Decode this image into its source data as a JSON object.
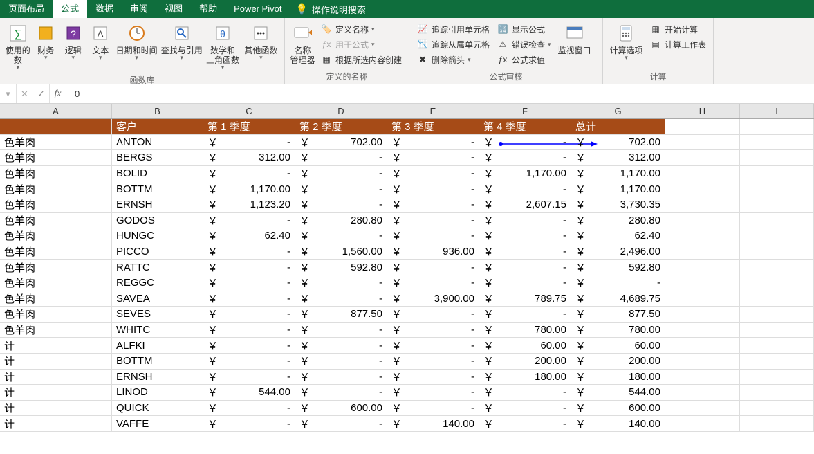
{
  "ribbon": {
    "tabs": [
      "页面布局",
      "公式",
      "数据",
      "审阅",
      "视图",
      "帮助",
      "Power Pivot"
    ],
    "active_tab": "公式",
    "search_placeholder": "操作说明搜索",
    "groups": {
      "func_lib": {
        "label": "函数库",
        "used": "使用的\n数",
        "finance": "财务",
        "logic": "逻辑",
        "text": "文本",
        "datetime": "日期和时间",
        "lookup": "查找与引用",
        "math": "数学和\n三角函数",
        "other": "其他函数"
      },
      "defined_names": {
        "label": "定义的名称",
        "name_mgr": "名称\n管理器",
        "define_name": "定义名称",
        "use_formula": "用于公式",
        "create_from_selection": "根据所选内容创建"
      },
      "formula_audit": {
        "label": "公式审核",
        "trace_precedents": "追踪引用单元格",
        "trace_dependents": "追踪从属单元格",
        "remove_arrows": "删除箭头",
        "show_formulas": "显示公式",
        "error_check": "错误检查",
        "evaluate": "公式求值",
        "watch_window": "监视窗口"
      },
      "calculation": {
        "label": "计算",
        "calc_options": "计算选项",
        "calc_now": "开始计算",
        "calc_sheet": "计算工作表"
      }
    }
  },
  "formula_bar": {
    "value": "0"
  },
  "columns": [
    "A",
    "B",
    "C",
    "D",
    "E",
    "F",
    "G",
    "H",
    "I"
  ],
  "header_row": {
    "A": "",
    "B": "客户",
    "C": "第 1 季度",
    "D": "第 2 季度",
    "E": "第 3 季度",
    "F": "第 4 季度",
    "G": "总计"
  },
  "rows": [
    {
      "A": "色羊肉",
      "B": "ANTON",
      "C": "-",
      "D": "702.00",
      "E": "-",
      "F": "-",
      "G": "702.00"
    },
    {
      "A": "色羊肉",
      "B": "BERGS",
      "C": "312.00",
      "D": "-",
      "E": "-",
      "F": "-",
      "G": "312.00"
    },
    {
      "A": "色羊肉",
      "B": "BOLID",
      "C": "-",
      "D": "-",
      "E": "-",
      "F": "1,170.00",
      "G": "1,170.00"
    },
    {
      "A": "色羊肉",
      "B": "BOTTM",
      "C": "1,170.00",
      "D": "-",
      "E": "-",
      "F": "-",
      "G": "1,170.00"
    },
    {
      "A": "色羊肉",
      "B": "ERNSH",
      "C": "1,123.20",
      "D": "-",
      "E": "-",
      "F": "2,607.15",
      "G": "3,730.35"
    },
    {
      "A": "色羊肉",
      "B": "GODOS",
      "C": "-",
      "D": "280.80",
      "E": "-",
      "F": "-",
      "G": "280.80"
    },
    {
      "A": "色羊肉",
      "B": "HUNGC",
      "C": "62.40",
      "D": "-",
      "E": "-",
      "F": "-",
      "G": "62.40"
    },
    {
      "A": "色羊肉",
      "B": "PICCO",
      "C": "-",
      "D": "1,560.00",
      "E": "936.00",
      "F": "-",
      "G": "2,496.00"
    },
    {
      "A": "色羊肉",
      "B": "RATTC",
      "C": "-",
      "D": "592.80",
      "E": "-",
      "F": "-",
      "G": "592.80"
    },
    {
      "A": "色羊肉",
      "B": "REGGC",
      "C": "-",
      "D": "-",
      "E": "-",
      "F": "-",
      "G": "-"
    },
    {
      "A": "色羊肉",
      "B": "SAVEA",
      "C": "-",
      "D": "-",
      "E": "3,900.00",
      "F": "789.75",
      "G": "4,689.75"
    },
    {
      "A": "色羊肉",
      "B": "SEVES",
      "C": "-",
      "D": "877.50",
      "E": "-",
      "F": "-",
      "G": "877.50"
    },
    {
      "A": "色羊肉",
      "B": "WHITC",
      "C": "-",
      "D": "-",
      "E": "-",
      "F": "780.00",
      "G": "780.00"
    },
    {
      "A": "计",
      "B": "ALFKI",
      "C": "-",
      "D": "-",
      "E": "-",
      "F": "60.00",
      "G": "60.00"
    },
    {
      "A": "计",
      "B": "BOTTM",
      "C": "-",
      "D": "-",
      "E": "-",
      "F": "200.00",
      "G": "200.00"
    },
    {
      "A": "计",
      "B": "ERNSH",
      "C": "-",
      "D": "-",
      "E": "-",
      "F": "180.00",
      "G": "180.00"
    },
    {
      "A": "计",
      "B": "LINOD",
      "C": "544.00",
      "D": "-",
      "E": "-",
      "F": "-",
      "G": "544.00"
    },
    {
      "A": "计",
      "B": "QUICK",
      "C": "-",
      "D": "600.00",
      "E": "-",
      "F": "-",
      "G": "600.00"
    },
    {
      "A": "计",
      "B": "VAFFE",
      "C": "-",
      "D": "-",
      "E": "140.00",
      "F": "-",
      "G": "140.00"
    }
  ],
  "currency_symbol": "￥"
}
